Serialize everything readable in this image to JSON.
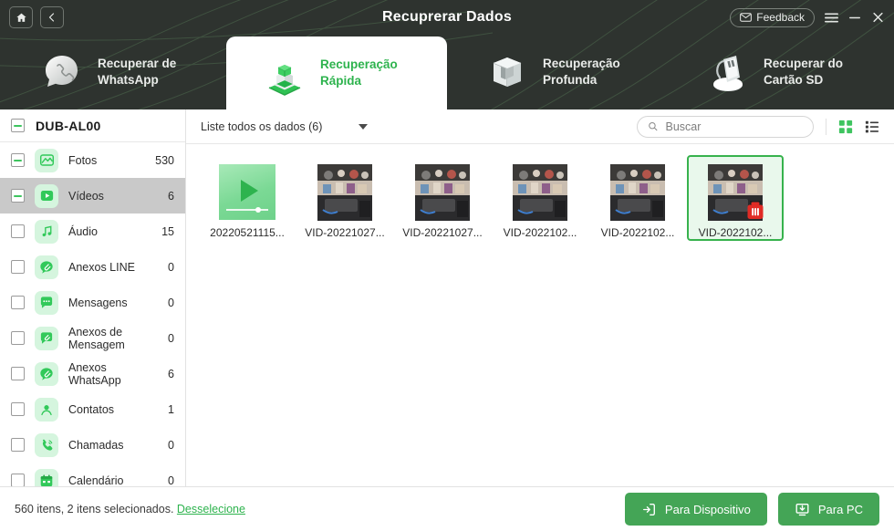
{
  "window": {
    "title": "Recuprerar Dados",
    "home_icon": "home-icon",
    "back_icon": "chevron-left-icon",
    "feedback_label": "Feedback",
    "feedback_icon": "envelope-icon",
    "menu_icon": "hamburger-menu-icon",
    "minimize_icon": "minimize-icon",
    "close_icon": "close-icon"
  },
  "tabs": [
    {
      "label": "Recuperar de WhatsApp",
      "icon": "whatsapp-phone-icon",
      "active": false
    },
    {
      "label": "Recuperação Rápida",
      "icon": "green-cube-icon",
      "active": true
    },
    {
      "label": "Recuperação Profunda",
      "icon": "gray-box-icon",
      "active": false
    },
    {
      "label": "Recuperar do Cartão SD",
      "icon": "sd-card-icon",
      "active": false
    }
  ],
  "sidebar": {
    "device": {
      "name": "DUB-AL00",
      "checkbox": "indeterminate"
    },
    "items": [
      {
        "label": "Fotos",
        "count": "530",
        "icon": "photo-icon",
        "checkbox": "indeterminate",
        "selected": false
      },
      {
        "label": "Vídeos",
        "count": "6",
        "icon": "video-icon",
        "checkbox": "indeterminate",
        "selected": true
      },
      {
        "label": "Áudio",
        "count": "15",
        "icon": "music-icon",
        "checkbox": "unchecked",
        "selected": false
      },
      {
        "label": "Anexos LINE",
        "count": "0",
        "icon": "line-attachment-icon",
        "checkbox": "unchecked",
        "selected": false
      },
      {
        "label": "Mensagens",
        "count": "0",
        "icon": "message-icon",
        "checkbox": "unchecked",
        "selected": false
      },
      {
        "label": "Anexos de Mensagem",
        "count": "0",
        "icon": "message-attachment-icon",
        "checkbox": "unchecked",
        "selected": false
      },
      {
        "label": "Anexos WhatsApp",
        "count": "6",
        "icon": "whatsapp-attachment-icon",
        "checkbox": "unchecked",
        "selected": false
      },
      {
        "label": "Contatos",
        "count": "1",
        "icon": "contact-icon",
        "checkbox": "unchecked",
        "selected": false
      },
      {
        "label": "Chamadas",
        "count": "0",
        "icon": "call-icon",
        "checkbox": "unchecked",
        "selected": false
      },
      {
        "label": "Calendário",
        "count": "0",
        "icon": "calendar-icon",
        "checkbox": "unchecked",
        "selected": false
      }
    ]
  },
  "toolbar": {
    "filter_label": "Liste todos os dados (6)",
    "search_placeholder": "Buscar",
    "search_value": "",
    "search_icon": "search-icon",
    "grid_view_icon": "grid-view-icon",
    "list_view_icon": "list-view-icon",
    "grid_view_active": true
  },
  "grid_items": [
    {
      "name": "20220521115...",
      "type": "placeholder",
      "selected": false,
      "deleted": false
    },
    {
      "name": "VID-20221027...",
      "type": "photo",
      "selected": false,
      "deleted": false
    },
    {
      "name": "VID-20221027...",
      "type": "photo",
      "selected": false,
      "deleted": false
    },
    {
      "name": "VID-2022102...",
      "type": "photo",
      "selected": false,
      "deleted": false
    },
    {
      "name": "VID-2022102...",
      "type": "photo",
      "selected": false,
      "deleted": false
    },
    {
      "name": "VID-2022102...",
      "type": "photo",
      "selected": true,
      "deleted": true
    }
  ],
  "footer": {
    "status_prefix": "560 itens, 2 itens selecionados.",
    "deselect_label": "Desselecione",
    "to_device_label": "Para Dispositivo",
    "to_device_icon": "export-to-device-icon",
    "to_pc_label": "Para PC",
    "to_pc_icon": "export-to-pc-icon"
  },
  "colors": {
    "header_bg": "#2e332f",
    "accent_green": "#2eb34e",
    "button_green": "#44a556",
    "icon_tile_bg": "#d5f5de",
    "selected_row_bg": "#c9c9c9"
  }
}
